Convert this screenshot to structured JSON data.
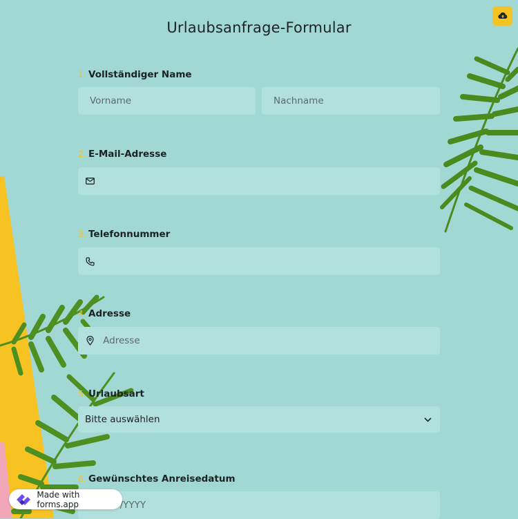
{
  "form": {
    "title": "Urlaubsanfrage-Formular",
    "questions": [
      {
        "number": "1.",
        "label": "Vollständiger Name"
      },
      {
        "number": "2.",
        "label": "E-Mail-Adresse"
      },
      {
        "number": "3.",
        "label": "Telefonnummer"
      },
      {
        "number": "4.",
        "label": "Adresse"
      },
      {
        "number": "5.",
        "label": "Urlaubsart"
      },
      {
        "number": "6.",
        "label": "Gewünschtes Anreisedatum"
      }
    ],
    "first_name_placeholder": "Vorname",
    "last_name_placeholder": "Nachname",
    "address_placeholder": "Adresse",
    "select_value": "Bitte auswählen",
    "date_placeholder": "MM/DD/YYYY"
  },
  "badge": {
    "text": "Made with forms.app"
  },
  "colors": {
    "background": "#a1d8d4",
    "field": "#b2e0dc",
    "accent": "#f6c323",
    "leaf": "#4b8a1f"
  },
  "icons": {
    "save": "cloud-upload-icon",
    "email": "envelope-icon",
    "phone": "phone-icon",
    "address": "map-pin-icon",
    "select": "chevron-down-icon",
    "brand": "forms-app-logo-icon"
  }
}
